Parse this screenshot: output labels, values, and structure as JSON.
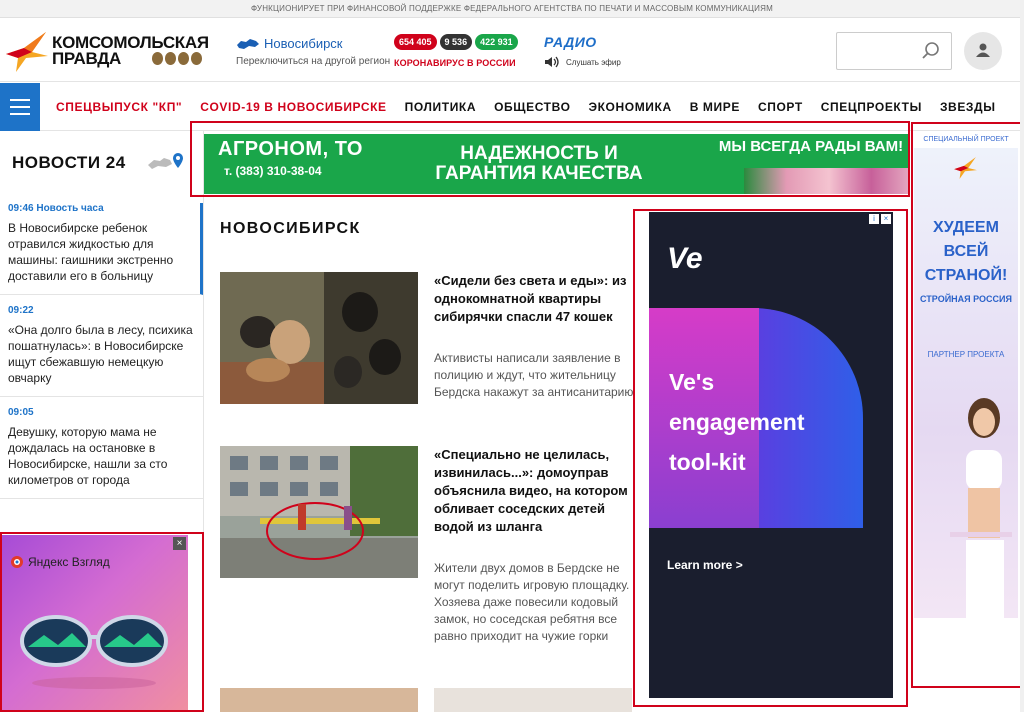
{
  "top_strip": "ФУНКЦИОНИРУЕТ ПРИ ФИНАНСОВОЙ ПОДДЕРЖКЕ ФЕДЕРАЛЬНОГО АГЕНТСТВА ПО ПЕЧАТИ И МАССОВЫМ КОММУНИКАЦИЯМ",
  "logo": {
    "line1": "КОМСОМОЛЬСКАЯ",
    "line2": "ПРАВДА"
  },
  "city": {
    "name": "Новосибирск",
    "switch": "Переключиться на другой регион"
  },
  "covid": {
    "badges": [
      {
        "value": "654 405",
        "color": "#d0021b"
      },
      {
        "value": "9 536",
        "color": "#333333"
      },
      {
        "value": "422 931",
        "color": "#1aa64a"
      }
    ],
    "label": "КОРОНАВИРУС В РОССИИ"
  },
  "radio": {
    "title": "РАДИО",
    "listen": "Слушать эфир"
  },
  "search": {
    "placeholder": ""
  },
  "nav": {
    "items": [
      {
        "label": "СПЕЦВЫПУСК \"КП\"",
        "red": true
      },
      {
        "label": "COVID-19 В НОВОСИБИРСКЕ",
        "red": true
      },
      {
        "label": "ПОЛИТИКА",
        "red": false
      },
      {
        "label": "ОБЩЕСТВО",
        "red": false
      },
      {
        "label": "ЭКОНОМИКА",
        "red": false
      },
      {
        "label": "В МИРЕ",
        "red": false
      },
      {
        "label": "СПОРТ",
        "red": false
      },
      {
        "label": "СПЕЦПРОЕКТЫ",
        "red": false
      },
      {
        "label": "ЗВЕЗДЫ",
        "red": false
      }
    ]
  },
  "sidebar": {
    "title": "НОВОСТИ 24",
    "feed": [
      {
        "time": "09:46 Новость часа",
        "text": "В Новосибирске ребенок отравился жидкостью для машины: гаишники экстренно доставили его в больницу"
      },
      {
        "time": "09:22",
        "text": "«Она долго была в лесу, психика пошатнулась»: в Новосибирске ищут сбежавшую немецкую овчарку"
      },
      {
        "time": "09:05",
        "text": "Девушку, которую мама не дождалась на остановке в Новосибирске, нашли за сто километров от города"
      }
    ]
  },
  "banner_top": {
    "company": "АГРОНОМ, ТО",
    "phone": "т. (383) 310-38-04",
    "center": "НАДЕЖНОСТЬ И ГАРАНТИЯ КАЧЕСТВА",
    "right": "МЫ ВСЕГДА РАДЫ ВАМ!"
  },
  "section_title": "НОВОСИБИРСК",
  "articles": [
    {
      "title": "«Сидели без света и еды»: из однокомнатной квартиры сибирячки спасли 47 кошек",
      "desc": "Активисты написали заявление в полицию и ждут, что жительницу Бердска накажут за антисанитарию"
    },
    {
      "title": "«Специально не целилась, извинилась...»: домоуправ объяснила видео, на котором обливает соседских детей водой из шланга",
      "desc": "Жители двух домов в Бердске не могут поделить игровую площадку. Хозяева даже повесили кодовый замок, но соседская ребятня все равно приходит на чужие горки"
    }
  ],
  "ad_ve": {
    "logo": "Ve",
    "headline_1": "Ve's",
    "headline_2": "engagement",
    "headline_3": "tool-kit",
    "cta": "Learn more  >"
  },
  "ad_side": {
    "label": "СПЕЦИАЛЬНЫЙ ПРОЕКТ",
    "slogan_1": "ХУДЕЕМ",
    "slogan_2": "ВСЕЙ",
    "slogan_3": "СТРАНОЙ!",
    "brand": "СТРОЙНАЯ РОССИЯ",
    "partner": "ПАРТНЕР ПРОЕКТА"
  },
  "ad_yandex": {
    "brand": "Яндекс Взгляд",
    "close": "×"
  }
}
